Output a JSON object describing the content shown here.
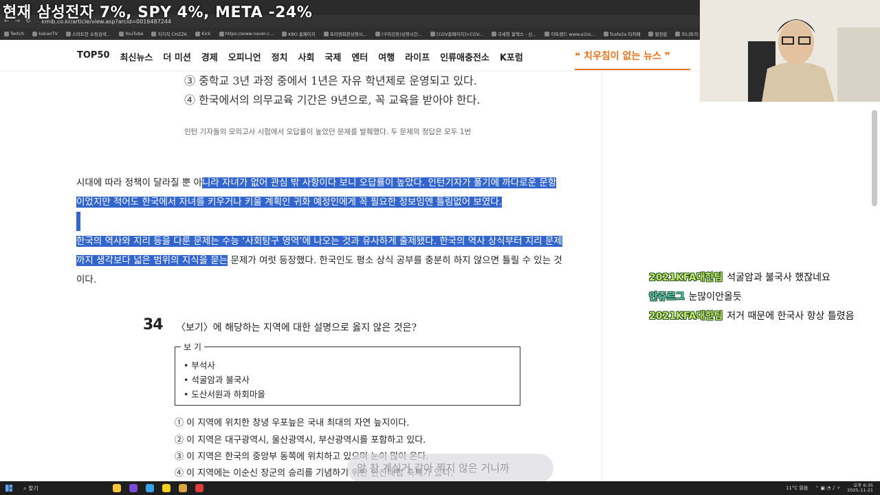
{
  "overlay_title": "현재 삼성전자 7%, SPY 4%, META -24%",
  "browser": {
    "url": "kmib.co.kr/article/view.asp?arcid=0016487244",
    "bookmarks": [
      "Twitch",
      "kakaoTV",
      "스마트한 쇼핑검색...",
      "YouTube",
      "치지직 CHZZK",
      "Kick",
      "https://www.naver.c...",
      "KBO 홈페이지",
      "프리영화관상영시...",
      "(구미강동)상영시간...",
      "[CGV홈페이지]<CGV...",
      "국세청 홈택스 - 신...",
      "이토랜드 www.e1to...",
      "Tcafe2a 티카페",
      "팔정합",
      "미니토끼 - 일본판..."
    ]
  },
  "site": {
    "nav": [
      "TOP50",
      "최신뉴스",
      "더 미션",
      "경제",
      "오피니언",
      "정치",
      "사회",
      "국제",
      "엔터",
      "여행",
      "라이프",
      "인류애충전소",
      "K포럼"
    ],
    "slogan": "❝ 치우침이 없는 뉴스 ❞"
  },
  "article": {
    "exam_top": [
      "③ 중학교 3년 과정 중에서 1년은 자유 학년제로 운영되고 있다.",
      "④ 한국에서의 의무교육 기간은 9년으로, 꼭 교육을 받아야 한다."
    ],
    "caption": "인턴 기자들의 모의고사 시험에서 오답률이 높았던 문제를 발췌했다. 두 문제의 정답은 모두 1번",
    "p1_l1_pre": "시대에 따라 정책이 달라질 뿐 아",
    "p1_l1_hl": "니라 자녀가 없어 관심 밖 사항이다 보니 오답률이 높았다. 인턴기자가 풀기에 까다로운 문항",
    "p1_l2_hl": "이었지만 적어도 한국에서 자녀를 키우거나 키울 계획인 귀화 예정인에게 꼭 필요한 정보임엔 틀림없어 보였다.",
    "p2_l1_hl": "한국의 역사와 지리 등을 다룬 문제는 수능 ‘사회탐구 영역’에 나오는 것과 유사하게 출제됐다. 한국의 역사 상식부터 지리 문제",
    "p2_l2_hl": "까지 생각보다 넓은 범위의 지식을 묻는",
    "p2_l2_post": " 문제가 여럿 등장했다. 한국인도 평소 상식 공부를 충분히 하지 않으면 틀릴 수 있는 것",
    "p2_l3": "이다.",
    "question": {
      "num": "34",
      "text": "〈보기〉에 해당하는 지역에 대한 설명으로 옳지 않은 것은?",
      "box_label": "보 기",
      "box_items": [
        "• 부석사",
        "• 석굴암과 불국사",
        "• 도산서원과 하회마을"
      ],
      "choices": [
        "① 이 지역에 위치한 창녕 우포늪은 국내 최대의 자연 늪지이다.",
        "② 이 지역은 대구광역시, 울산광역시, 부산광역시를 포함하고 있다.",
        "③ 이 지역은 한국의 중앙부 동쪽에 위치하고 있으며 눈이 많이 온다.",
        "④ 이 지역에는 이순신 장군의 승리를 기념하기 위한 한산대첩 축제가 있다."
      ]
    },
    "bubble": "앞 찬 계실거 같아 찍지 않은 거니까"
  },
  "chat": [
    {
      "nick": "2021KFA대한팀",
      "msg": "석굴암과 불국사 했잖네요"
    },
    {
      "nick": "안쥬르그",
      "msg": "눈많이안올듯"
    },
    {
      "nick": "2021KFA대한팀",
      "msg": "저거 때문에 한국사 항상 틀렸음"
    }
  ],
  "taskbar": {
    "search": "찾기",
    "weather": "11°C 맑음",
    "time": "오후 6:35",
    "date": "2025-11-21"
  }
}
